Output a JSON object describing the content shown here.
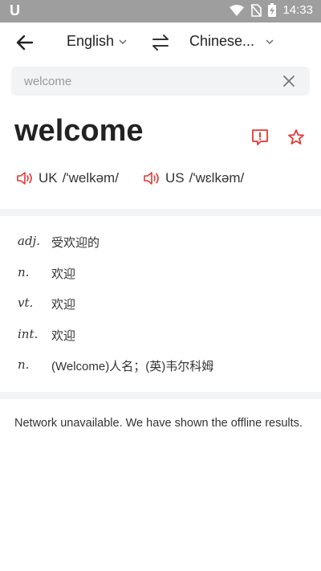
{
  "statusbar": {
    "app_icon": "U",
    "time": "14:33",
    "icons": [
      "wifi-icon",
      "no-sim-icon",
      "battery-charging-icon"
    ]
  },
  "topbar": {
    "source_lang": "English",
    "target_lang": "Chinese...",
    "icons": [
      "back-arrow-icon",
      "chevron-down-icon",
      "swap-icon"
    ]
  },
  "search": {
    "value": "welcome",
    "placeholder": ""
  },
  "entry": {
    "word": "welcome",
    "uk_label": "UK",
    "uk_phonetic": "/'welkəm/",
    "us_label": "US",
    "us_phonetic": "/'wɛlkəm/"
  },
  "definitions": [
    {
      "pos": "adj.",
      "meaning": "受欢迎的"
    },
    {
      "pos": "n.",
      "meaning": "欢迎"
    },
    {
      "pos": "vt.",
      "meaning": "欢迎"
    },
    {
      "pos": "int.",
      "meaning": "欢迎"
    },
    {
      "pos": "n.",
      "meaning": "(Welcome)人名；(英)韦尔科姆"
    }
  ],
  "notice": "Network unavailable. We have shown the offline results.",
  "colors": {
    "accent": "#e53935",
    "statusbar": "#9e9e9e",
    "search_bg": "#f2f3f5"
  }
}
